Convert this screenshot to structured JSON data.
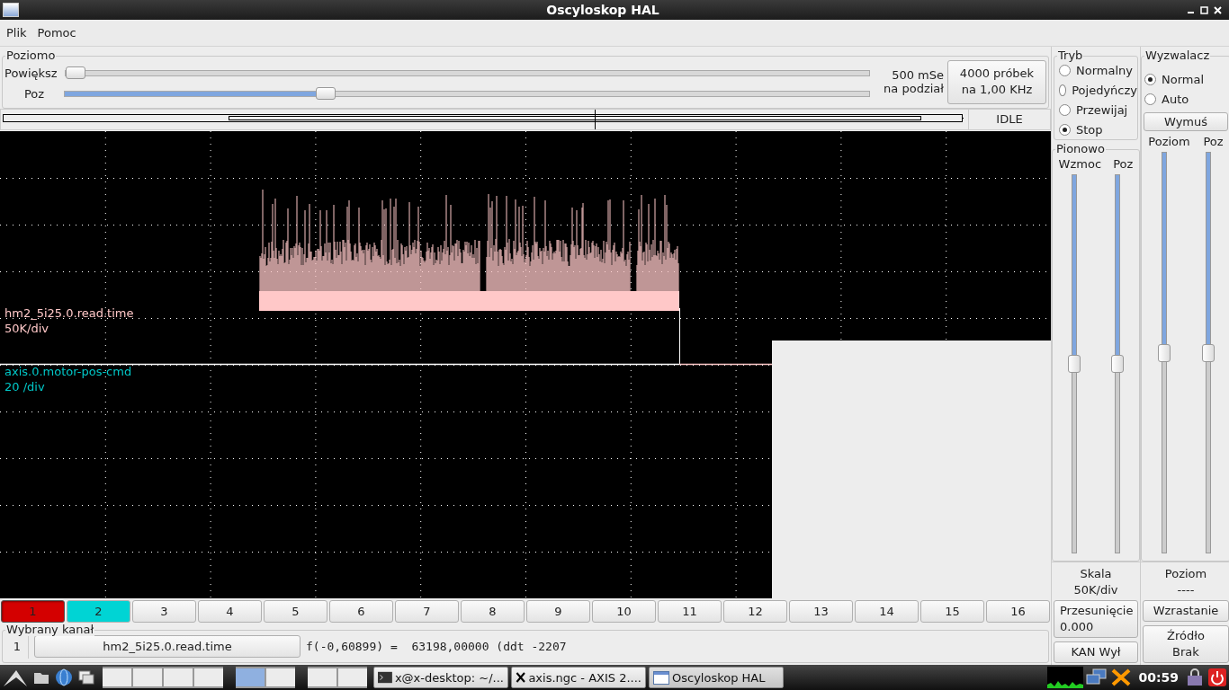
{
  "window": {
    "title": "Oscyloskop HAL"
  },
  "menu": [
    "Plik",
    "Pomoc"
  ],
  "horizontal": {
    "title": "Poziomo",
    "sliders": [
      {
        "label": "Powiększ",
        "level": 0
      },
      {
        "label": "Poz",
        "level": 0.32
      }
    ],
    "scale": [
      "500 mSe",
      "na podział"
    ],
    "samples_button": [
      "4000 próbek",
      "na 1,00 KHz"
    ]
  },
  "overview": {
    "status": "IDLE"
  },
  "scope": {
    "traces": [
      {
        "name": "hm2_5i25.0.read.time",
        "scale": "50K/div",
        "color": "#ffc8c8"
      },
      {
        "name": "axis.0.motor-pos-cmd",
        "scale": "20 /div",
        "color": "#00c8c8"
      }
    ]
  },
  "channels": [
    {
      "label": "1",
      "selected": true,
      "color": "#d40000"
    },
    {
      "label": "2",
      "selected": false,
      "color": "#00d4d4"
    },
    {
      "label": "3",
      "selected": false
    },
    {
      "label": "4",
      "selected": false
    },
    {
      "label": "5",
      "selected": false
    },
    {
      "label": "6",
      "selected": false
    },
    {
      "label": "7",
      "selected": false
    },
    {
      "label": "8",
      "selected": false
    },
    {
      "label": "9",
      "selected": false
    },
    {
      "label": "10",
      "selected": false
    },
    {
      "label": "11",
      "selected": false
    },
    {
      "label": "12",
      "selected": false
    },
    {
      "label": "13",
      "selected": false
    },
    {
      "label": "14",
      "selected": false
    },
    {
      "label": "15",
      "selected": false
    },
    {
      "label": "16",
      "selected": false
    }
  ],
  "selected_channel": {
    "title": "Wybrany kanał",
    "number": "1",
    "name_button": "hm2_5i25.0.read.time",
    "readout": "f(-0,60899) =  63198,00000 (ddt -2207"
  },
  "mode": {
    "title": "Tryb",
    "options": [
      {
        "label": "Normalny",
        "selected": false
      },
      {
        "label": "Pojedyńczy",
        "selected": false
      },
      {
        "label": "Przewijaj",
        "selected": false
      },
      {
        "label": "Stop",
        "selected": true
      }
    ]
  },
  "vertical": {
    "title": "Pionowo",
    "sliders": [
      {
        "label": "Wzmoc",
        "level": 0.5
      },
      {
        "label": "Poz",
        "level": 0.5
      }
    ],
    "scale_label": "Skala",
    "scale_value": "50K/div",
    "offset_button": [
      "Przesunięcie",
      "0.000"
    ],
    "channel_off_button": "KAN Wył"
  },
  "trigger": {
    "title": "Wyzwalacz",
    "options": [
      {
        "label": "Normal",
        "selected": true
      },
      {
        "label": "Auto",
        "selected": false
      }
    ],
    "force_button": "Wymuś",
    "sliders": [
      {
        "label": "Poziom",
        "level": 0.5
      },
      {
        "label": "Poz",
        "level": 0.5
      }
    ],
    "level_label": "Poziom",
    "level_value": "----",
    "edge_button": "Wzrastanie",
    "source_button": [
      "Źródło",
      "Brak"
    ]
  },
  "taskbar": {
    "pager": [
      [
        false,
        false,
        false,
        false
      ],
      [
        true,
        false
      ],
      [
        false,
        false
      ]
    ],
    "tasks": [
      {
        "label": "x@x-desktop: ~/...",
        "kind": "terminal",
        "selected": false
      },
      {
        "label": "axis.ngc - AXIS 2....",
        "kind": "x",
        "selected": false
      },
      {
        "label": "Oscyloskop HAL",
        "kind": "window",
        "selected": true
      }
    ],
    "clock": "00:59"
  }
}
